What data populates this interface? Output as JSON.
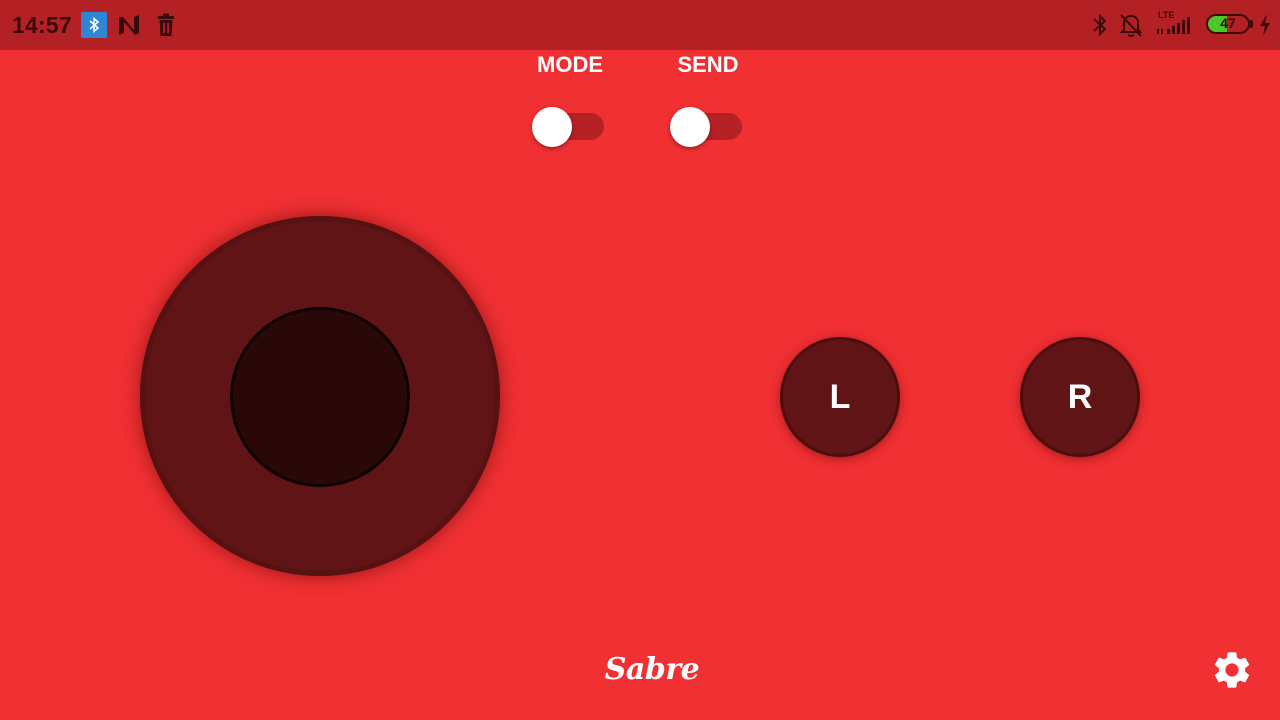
{
  "status_bar": {
    "time": "14:57",
    "battery_level": "47",
    "battery_fraction": 0.47,
    "network_type": "LTE",
    "icons": [
      "bluetooth-notification-icon",
      "n-app-icon",
      "trash-icon",
      "bluetooth-icon",
      "bell-off-icon",
      "signal-icon",
      "battery-icon",
      "charging-icon"
    ]
  },
  "toggles": {
    "mode_label": "MODE",
    "send_label": "SEND",
    "mode_on": false,
    "send_on": false
  },
  "buttons": {
    "left_label": "L",
    "right_label": "R"
  },
  "footer": {
    "logo_text": "Sabre",
    "settings_icon": "gear-icon"
  },
  "colors": {
    "background": "#f03033",
    "status_bar": "#b42125",
    "control": "#611415",
    "knob": "#2b0808",
    "battery": "#4cc62b"
  }
}
